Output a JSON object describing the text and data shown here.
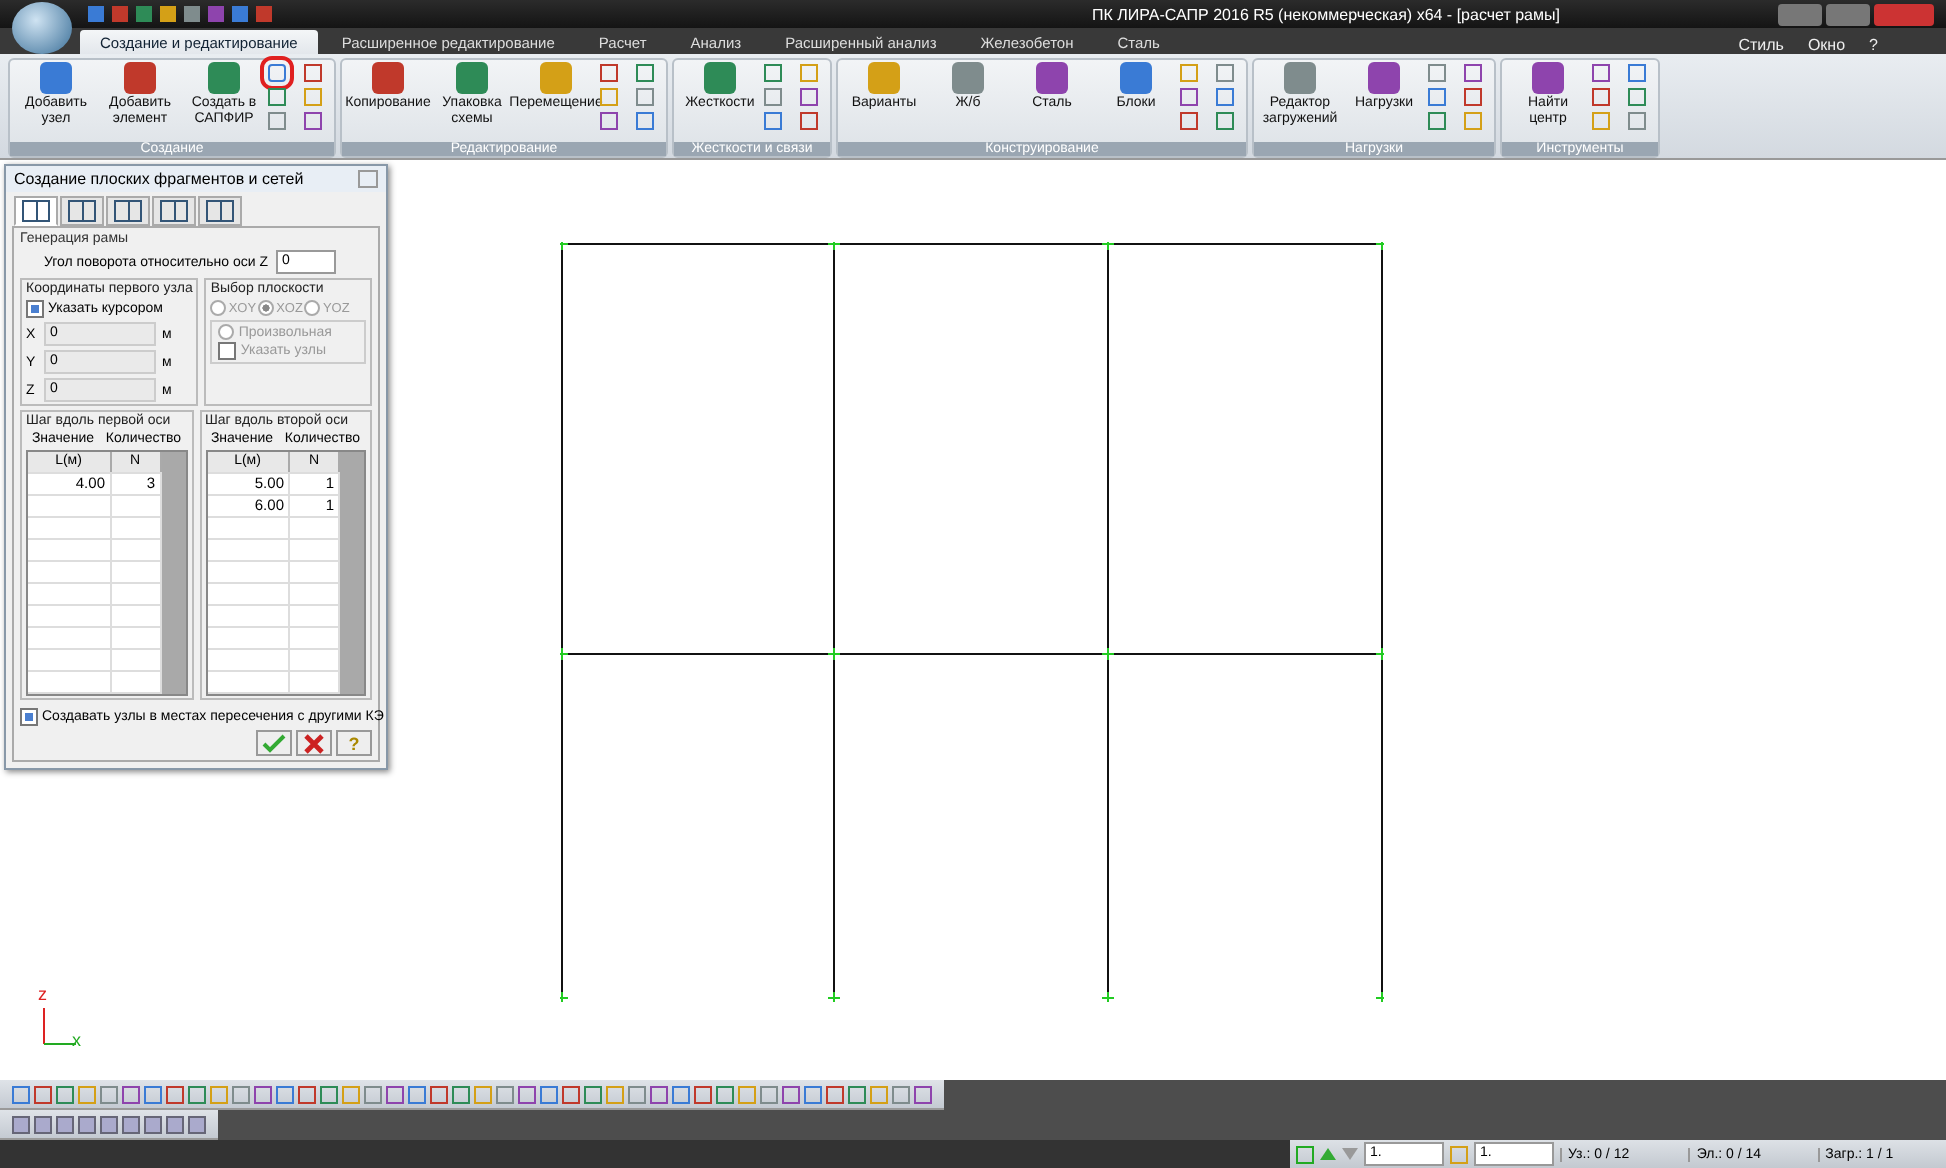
{
  "window": {
    "title": "ПК ЛИРА-САПР  2016 R5 (некоммерческая) x64 - [расчет рамы]"
  },
  "tabs": [
    {
      "label": "Создание и редактирование",
      "selected": true
    },
    {
      "label": "Расширенное редактирование",
      "selected": false
    },
    {
      "label": "Расчет",
      "selected": false
    },
    {
      "label": "Анализ",
      "selected": false
    },
    {
      "label": "Расширенный анализ",
      "selected": false
    },
    {
      "label": "Железобетон",
      "selected": false
    },
    {
      "label": "Сталь",
      "selected": false
    }
  ],
  "menu_right": [
    "Стиль",
    "Окно",
    "?"
  ],
  "ribbon": [
    {
      "title": "Создание",
      "circled_tool": true,
      "buttons": [
        "Добавить узел",
        "Добавить элемент",
        "Создать в САПФИР"
      ]
    },
    {
      "title": "Редактирование",
      "circled_tool": false,
      "buttons": [
        "Копирование",
        "Упаковка схемы",
        "Перемещение"
      ]
    },
    {
      "title": "Жесткости и связи",
      "circled_tool": false,
      "buttons": [
        "Жесткости"
      ]
    },
    {
      "title": "Конструирование",
      "circled_tool": false,
      "buttons": [
        "Варианты",
        "Ж/б",
        "Сталь",
        "Блоки"
      ]
    },
    {
      "title": "Нагрузки",
      "circled_tool": false,
      "buttons": [
        "Редактор загружений",
        "Нагрузки"
      ]
    },
    {
      "title": "Инструменты",
      "circled_tool": false,
      "buttons": [
        "Найти центр"
      ]
    }
  ],
  "dialog": {
    "title": "Создание плоских фрагментов и сетей",
    "tabs": [
      {
        "selected": true
      },
      {
        "selected": false
      },
      {
        "selected": false
      },
      {
        "selected": false
      },
      {
        "selected": false
      }
    ],
    "section": "Генерация рамы",
    "angle_label": "Угол поворота относительно оси Z",
    "angle_value": "0",
    "coords_title": "Координаты первого узла",
    "cursor_checkbox": {
      "label": "Указать курсором",
      "checked": true
    },
    "coords": [
      {
        "axis": "X",
        "value": "0",
        "unit": "м"
      },
      {
        "axis": "Y",
        "value": "0",
        "unit": "м"
      },
      {
        "axis": "Z",
        "value": "0",
        "unit": "м"
      }
    ],
    "plane_title": "Выбор плоскости",
    "planes": [
      {
        "label": "XOY",
        "selected": false
      },
      {
        "label": "XOZ",
        "selected": true
      },
      {
        "label": "YOZ",
        "selected": false
      }
    ],
    "arbitrary": {
      "label": "Произвольная",
      "selected": false
    },
    "nodes_checkbox": {
      "label": "Указать узлы",
      "checked": false
    },
    "steps": [
      {
        "title": "Шаг вдоль первой оси",
        "header_1": "Значение",
        "header_2": "Количество",
        "columns": [
          "L(м)",
          "N"
        ],
        "rows": [
          [
            "4.00",
            "3"
          ]
        ]
      },
      {
        "title": "Шаг вдоль второй оси",
        "header_1": "Значение",
        "header_2": "Количество",
        "columns": [
          "L(м)",
          "N"
        ],
        "rows": [
          [
            "5.00",
            "1"
          ],
          [
            "6.00",
            "1"
          ]
        ]
      }
    ],
    "intersect_checkbox": {
      "label": "Создавать узлы в местах пересечения с другими КЭ",
      "checked": true
    },
    "help_label": "?"
  },
  "axes": {
    "z": "z",
    "x": "x"
  },
  "status": {
    "combo_1": "1.",
    "combo_2": "1.",
    "nodes": "Уз.: 0 / 12",
    "elements": "Эл.: 0 / 14",
    "loads": "Загр.: 1 / 1"
  }
}
